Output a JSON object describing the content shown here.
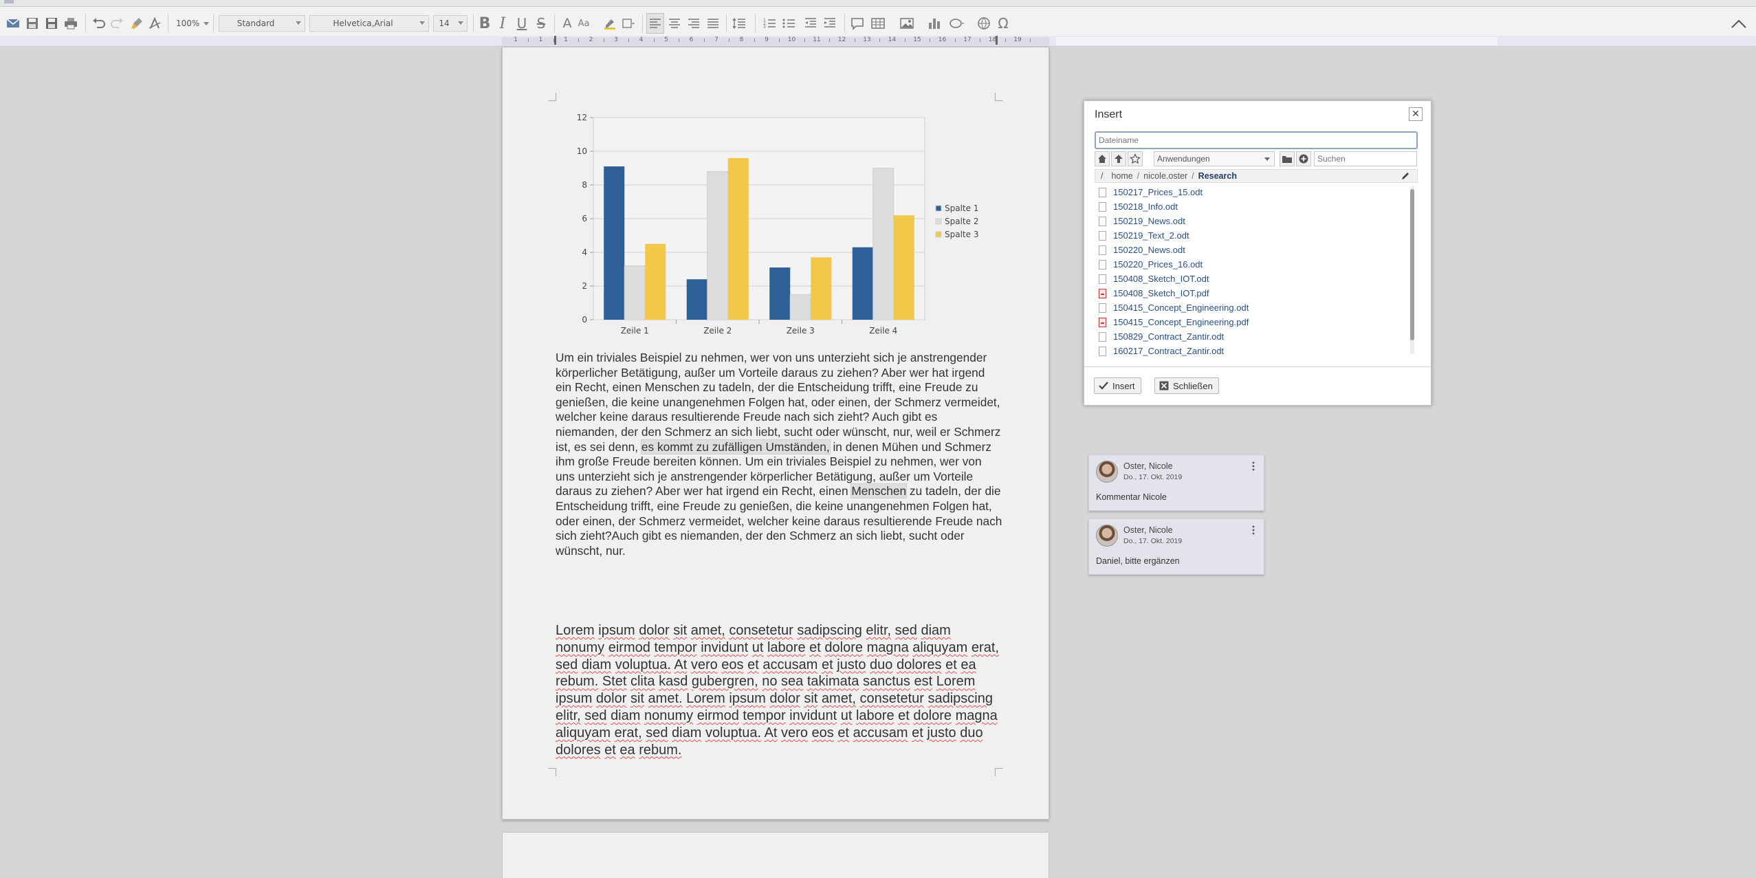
{
  "toolbar": {
    "zoom": "100%",
    "paragraph_style": "Standard",
    "font_family": "Helvetica,Arial",
    "font_size": "14"
  },
  "ruler": {
    "numbers": [
      "1",
      "1",
      "1",
      "2",
      "3",
      "4",
      "5",
      "6",
      "7",
      "8",
      "9",
      "10",
      "11",
      "12",
      "13",
      "14",
      "15",
      "16",
      "17",
      "18",
      "19"
    ]
  },
  "chart_data": {
    "type": "bar",
    "categories": [
      "Zeile 1",
      "Zeile 2",
      "Zeile 3",
      "Zeile 4"
    ],
    "series": [
      {
        "name": "Spalte 1",
        "values": [
          9.1,
          2.4,
          3.1,
          4.3
        ]
      },
      {
        "name": "Spalte 2",
        "values": [
          3.2,
          8.8,
          1.5,
          9.0
        ]
      },
      {
        "name": "Spalte 3",
        "values": [
          4.5,
          9.6,
          3.7,
          6.2
        ]
      }
    ],
    "ylim": [
      0,
      12
    ],
    "yticks": [
      "0",
      "2",
      "4",
      "6",
      "8",
      "10",
      "12"
    ],
    "grid": true,
    "legend_position": "right",
    "colors": [
      "#2f5f97",
      "#dcdcdc",
      "#f2c84b"
    ]
  },
  "document": {
    "p1_before": "Um ein triviales Beispiel zu nehmen, wer von uns unterzieht sich je anstrengender körperlicher Betätigung, außer um Vorteile daraus zu ziehen? Aber wer hat irgend ein Recht, einen Menschen zu tadeln, der die Entscheidung trifft, eine Freude zu genießen, die keine unangenehmen Folgen hat, oder einen, der Schmerz vermeidet, welcher keine daraus resultierende Freude nach sich zieht? Auch gibt es niemanden, der den Schmerz an sich liebt, sucht oder wünscht, nur, weil er Schmerz ist, es sei denn, ",
    "p1_highlight1": "es kommt zu zufälligen Umständen,",
    "p1_middle": " in denen Mühen und Schmerz ihm große Freude bereiten können. Um ein triviales Beispiel zu nehmen, wer von uns unterzieht sich je anstrengender körperlicher Betätigung, außer um Vorteile daraus zu ziehen? Aber wer hat irgend ein Recht, einen ",
    "p1_highlight2": "Menschen",
    "p1_after": " zu tadeln, der die Entscheidung trifft, eine Freude zu genießen, die keine unangenehmen Folgen hat, oder einen, der Schmerz vermeidet, welcher keine daraus resultierende Freude nach sich zieht?Auch gibt es niemanden, der den Schmerz an sich liebt, sucht oder wünscht, nur.",
    "p2": "Lorem ipsum dolor sit amet, consetetur sadipscing elitr, sed diam nonumy eirmod tempor invidunt ut labore et dolore magna aliquyam erat, sed diam voluptua. At vero eos et accusam et justo duo dolores et ea rebum. Stet clita kasd gubergren, no sea takimata sanctus est Lorem ipsum dolor sit amet. Lorem ipsum dolor sit amet, consetetur sadipscing elitr, sed diam nonumy eirmod tempor invidunt ut labore et dolore magna aliquyam erat, sed diam voluptua. At vero eos et accusam et justo duo dolores et ea rebum."
  },
  "dialog": {
    "title": "Insert",
    "close_glyph": "✕",
    "filename_placeholder": "Dateiname",
    "folder_select": "Anwendungen",
    "search_placeholder": "Suchen",
    "breadcrumb": {
      "root": "/",
      "parts": [
        "home",
        "nicole.oster"
      ],
      "current": "Research"
    },
    "files": [
      {
        "name": "150217_Prices_15.odt",
        "type": "odt"
      },
      {
        "name": "150218_Info.odt",
        "type": "odt"
      },
      {
        "name": "150219_News.odt",
        "type": "odt"
      },
      {
        "name": "150219_Text_2.odt",
        "type": "odt"
      },
      {
        "name": "150220_News.odt",
        "type": "odt"
      },
      {
        "name": "150220_Prices_16.odt",
        "type": "odt"
      },
      {
        "name": "150408_Sketch_IOT.odt",
        "type": "odt"
      },
      {
        "name": "150408_Sketch_IOT.pdf",
        "type": "pdf"
      },
      {
        "name": "150415_Concept_Engineering.odt",
        "type": "odt"
      },
      {
        "name": "150415_Concept_Engineering.pdf",
        "type": "pdf"
      },
      {
        "name": "150829_Contract_Zantir.odt",
        "type": "odt"
      },
      {
        "name": "160217_Contract_Zantir.odt",
        "type": "odt"
      }
    ],
    "insert_label": "Insert",
    "close_label": "Schließen"
  },
  "comments": [
    {
      "author": "Oster, Nicole",
      "date": "Do., 17. Okt. 2019",
      "text": "Kommentar Nicole"
    },
    {
      "author": "Oster, Nicole",
      "date": "Do., 17. Okt. 2019",
      "text": "Daniel, bitte ergänzen"
    }
  ]
}
